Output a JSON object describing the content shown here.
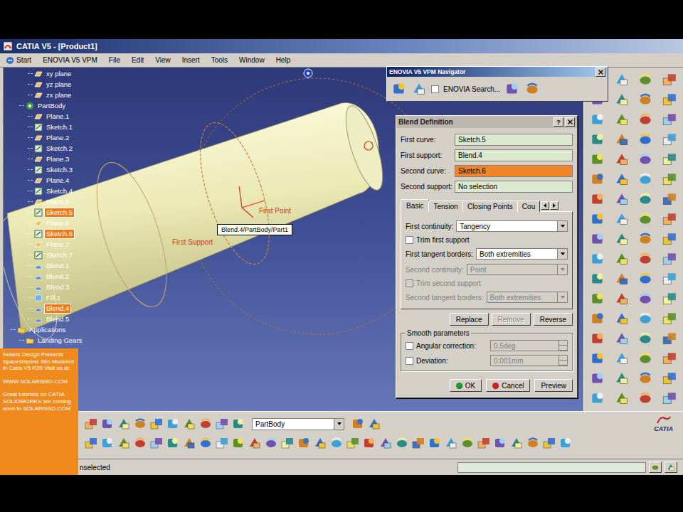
{
  "window": {
    "title": "CATIA V5 - [Product1]"
  },
  "menu": [
    "Start",
    "ENOVIA V5 VPM",
    "File",
    "Edit",
    "View",
    "Insert",
    "Tools",
    "Window",
    "Help"
  ],
  "tree": {
    "items": [
      {
        "label": "xy plane",
        "kind": "plane",
        "depth": 2,
        "selected": false
      },
      {
        "label": "yz plane",
        "kind": "plane",
        "depth": 2,
        "selected": false
      },
      {
        "label": "zx plane",
        "kind": "plane",
        "depth": 2,
        "selected": false
      },
      {
        "label": "PartBody",
        "kind": "body",
        "depth": 1,
        "selected": false
      },
      {
        "label": "Plane.1",
        "kind": "plane",
        "depth": 2,
        "selected": false
      },
      {
        "label": "Sketch.1",
        "kind": "sketch",
        "depth": 2,
        "selected": false
      },
      {
        "label": "Plane.2",
        "kind": "plane",
        "depth": 2,
        "selected": false
      },
      {
        "label": "Sketch.2",
        "kind": "sketch",
        "depth": 2,
        "selected": false
      },
      {
        "label": "Plane.3",
        "kind": "plane",
        "depth": 2,
        "selected": false
      },
      {
        "label": "Sketch.3",
        "kind": "sketch",
        "depth": 2,
        "selected": false
      },
      {
        "label": "Plane.4",
        "kind": "plane",
        "depth": 2,
        "selected": false
      },
      {
        "label": "Sketch.4",
        "kind": "sketch",
        "depth": 2,
        "selected": false
      },
      {
        "label": "Plane.5",
        "kind": "plane",
        "depth": 2,
        "selected": false
      },
      {
        "label": "Sketch.5",
        "kind": "sketch",
        "depth": 2,
        "selected": true
      },
      {
        "label": "Plane.6",
        "kind": "plane",
        "depth": 2,
        "selected": false
      },
      {
        "label": "Sketch.6",
        "kind": "sketch",
        "depth": 2,
        "selected": true
      },
      {
        "label": "Plane.7",
        "kind": "plane",
        "depth": 2,
        "selected": false
      },
      {
        "label": "Sketch.7",
        "kind": "sketch",
        "depth": 2,
        "selected": false
      },
      {
        "label": "Blend.1",
        "kind": "blend",
        "depth": 2,
        "selected": false
      },
      {
        "label": "Blend.2",
        "kind": "blend",
        "depth": 2,
        "selected": false
      },
      {
        "label": "Blend.3",
        "kind": "blend",
        "depth": 2,
        "selected": false
      },
      {
        "label": "Fill.1",
        "kind": "fill",
        "depth": 2,
        "selected": false
      },
      {
        "label": "Blend.4",
        "kind": "blend",
        "depth": 2,
        "selected": true
      },
      {
        "label": "Blend.5",
        "kind": "blend",
        "depth": 2,
        "selected": false
      },
      {
        "label": "Applications",
        "kind": "app",
        "depth": 0,
        "selected": false
      },
      {
        "label": "Landing Gears",
        "kind": "app",
        "depth": 1,
        "selected": false
      }
    ]
  },
  "viewport": {
    "labels": [
      "First Point",
      "First Support"
    ],
    "tooltip": "Blend.4/PartBody/Part1"
  },
  "navigator": {
    "title": "ENOVIA V5 VPM Navigator",
    "search": {
      "label": "ENOVIA Search...",
      "checked": false
    }
  },
  "dialog": {
    "title": "Blend Definition",
    "help": "?",
    "fields": [
      {
        "label": "First curve:",
        "value": "Sketch.5",
        "selected": false
      },
      {
        "label": "First support:",
        "value": "Blend.4",
        "selected": false
      },
      {
        "label": "Second curve:",
        "value": "Sketch.6",
        "selected": true
      },
      {
        "label": "Second support:",
        "value": "No selection",
        "selected": false
      }
    ],
    "tabs": [
      {
        "label": "Basic",
        "selected": true
      },
      {
        "label": "Tension",
        "selected": false
      },
      {
        "label": "Closing Points",
        "selected": false
      },
      {
        "label": "Cou",
        "selected": false
      }
    ],
    "options": [
      {
        "kind": "select",
        "label": "First continuity:",
        "value": "Tangency",
        "disabled": false
      },
      {
        "kind": "checkbox",
        "label": "Trim first support",
        "checked": false,
        "disabled": false
      },
      {
        "kind": "select",
        "label": "First tangent borders:",
        "value": "Both extremities",
        "disabled": false
      },
      {
        "kind": "select",
        "label": "Second continuity:",
        "value": "Point",
        "disabled": true
      },
      {
        "kind": "checkbox",
        "label": "Trim second support",
        "checked": false,
        "disabled": true
      },
      {
        "kind": "select",
        "label": "Second tangent borders:",
        "value": "Both extremities",
        "disabled": true
      }
    ],
    "actions": [
      {
        "label": "Replace",
        "disabled": false
      },
      {
        "label": "Remove",
        "disabled": true
      },
      {
        "label": "Reverse",
        "disabled": false
      }
    ],
    "smooth": {
      "title": "Smooth parameters",
      "rows": [
        {
          "label": "Angular correction:",
          "checked": false,
          "value": "0.5deg",
          "disabled": true
        },
        {
          "label": "Deviation:",
          "checked": false,
          "value": "0.001mm",
          "disabled": true
        }
      ]
    },
    "buttons": [
      {
        "label": "OK",
        "color": "#1f9a2a"
      },
      {
        "label": "Cancel",
        "color": "#d42020"
      },
      {
        "label": "Preview"
      }
    ]
  },
  "bottom": {
    "part_select": "PartBody",
    "logo": "CATIA"
  },
  "status_bar": {
    "message": "nselected"
  },
  "watermark": {
    "paragraphs": [
      "Solaris Design Presents Spaceshipone Sim Modeled in Catia V5 R20 Visit us at:",
      "WWW.SOLARISSD.COM",
      "Great tutorials on CATIA SOLIDWORKS are coming soon to SOLARISSD.COM"
    ]
  }
}
